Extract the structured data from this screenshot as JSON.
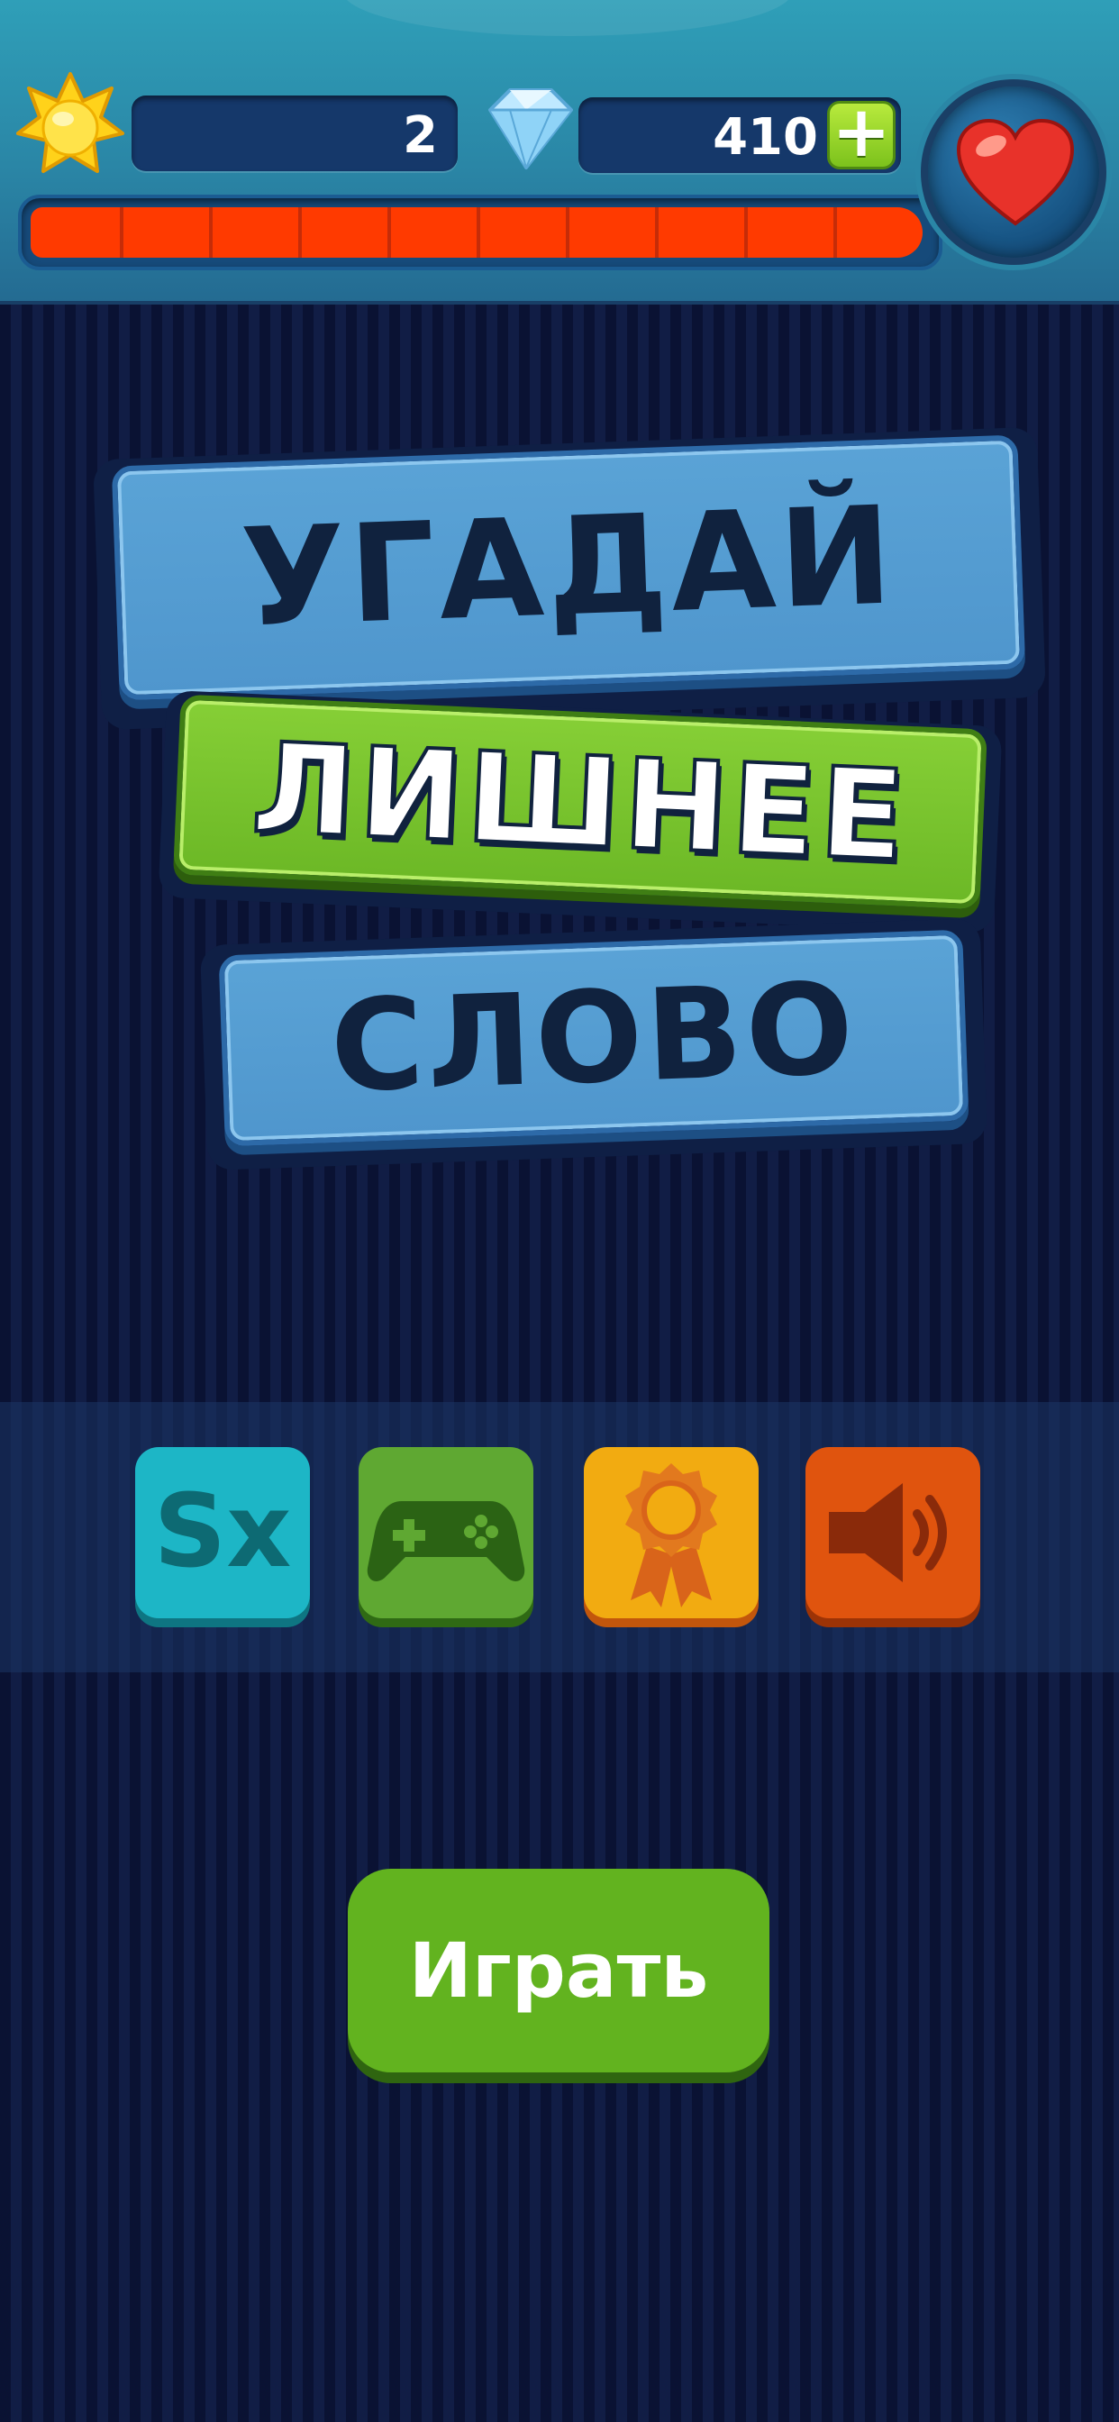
{
  "hud": {
    "level": "2",
    "gems": "410",
    "plus_label": "+",
    "lives_progress": 1.0
  },
  "logo": {
    "line1": "УГАДАЙ",
    "line2": "ЛИШНЕЕ",
    "line3": "СЛОВО"
  },
  "menu": {
    "items": [
      {
        "icon": "sx-logo-icon",
        "color": "#1db6c6"
      },
      {
        "icon": "gamepad-icon",
        "color": "#5fa832"
      },
      {
        "icon": "award-ribbon-icon",
        "color": "#f2ab11"
      },
      {
        "icon": "speaker-icon",
        "color": "#e0540e"
      }
    ],
    "sx_text": "Sx"
  },
  "play_button": {
    "label": "Играть"
  },
  "colors": {
    "progress_red": "#ff3a00",
    "play_green": "#62b31f",
    "background_navy": "#0c1638"
  }
}
